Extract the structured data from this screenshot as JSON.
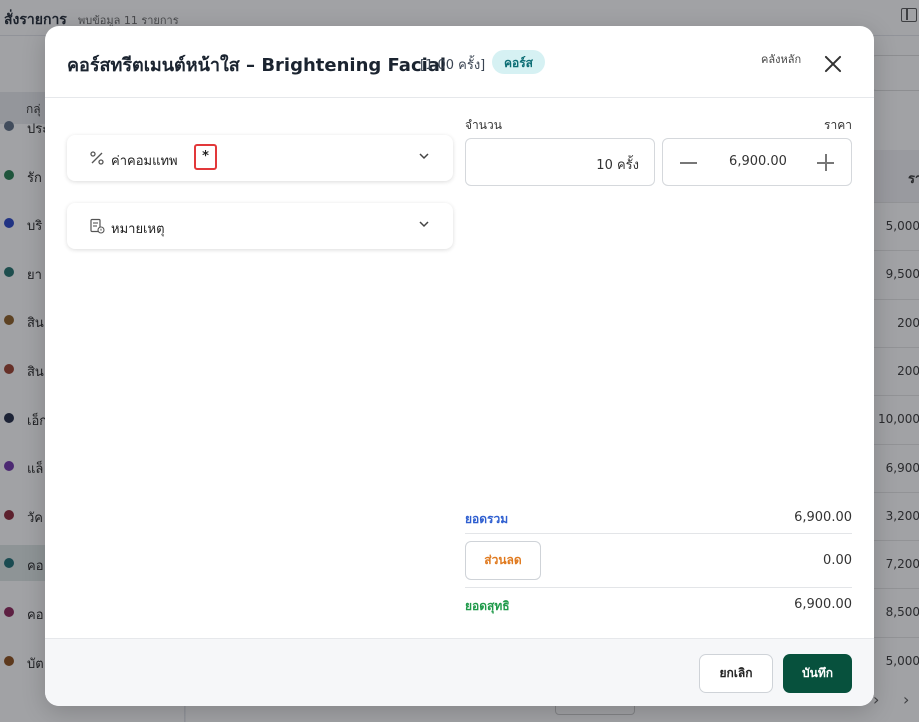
{
  "background": {
    "title": "สั่งรายการ",
    "subtitle": "พบข้อมูล 11 รายการ",
    "group_button": "กลุ่",
    "categories": [
      {
        "label": "ประ",
        "color": "#5b6b82"
      },
      {
        "label": "รัก",
        "color": "#1f7a4a"
      },
      {
        "label": "บริ",
        "color": "#2340c4"
      },
      {
        "label": "ยา",
        "color": "#1e6f6a"
      },
      {
        "label": "สิน",
        "color": "#8a5a1f"
      },
      {
        "label": "สิน",
        "color": "#9a3b28"
      },
      {
        "label": "เอ็ก",
        "color": "#1c2540"
      },
      {
        "label": "แล็",
        "color": "#6d2fa8"
      },
      {
        "label": "วัค",
        "color": "#8a2233"
      },
      {
        "label": "คอ",
        "color": "#17696f"
      },
      {
        "label": "คอ",
        "color": "#8a1f55"
      },
      {
        "label": "บัต",
        "color": "#8a4a15"
      }
    ],
    "table_header": "รา",
    "prices": [
      "5,000",
      "9,500",
      "200",
      "200",
      "10,000",
      "6,900",
      "3,200",
      "7,200",
      "8,500",
      "5,000"
    ]
  },
  "modal": {
    "title": "คอร์สทรีตเมนต์หน้าใส – Brightening Facial",
    "quantity_label": "[1.00 ครั้ง]",
    "badge": "คอร์ส",
    "warehouse": "คลังหลัก",
    "sections": {
      "commission": "ค่าคอมแทพ",
      "required_mark": "*",
      "note": "หมายเหตุ"
    },
    "fields": {
      "quantity_header": "จำนวน",
      "price_header": "ราคา",
      "quantity_value": "10 ครั้ง",
      "price_value": "6,900.00"
    },
    "summary": {
      "total_label": "ยอดรวม",
      "total_value": "6,900.00",
      "discount_label": "ส่วนลด",
      "discount_value": "0.00",
      "net_label": "ยอดสุทธิ",
      "net_value": "6,900.00"
    },
    "buttons": {
      "cancel": "ยกเลิก",
      "save": "บันทึก"
    },
    "colors": {
      "primary": "#07513d",
      "badge_bg": "#d6f1f3",
      "total_label": "#2f5fd0",
      "net_label": "#1f9a4a",
      "discount": "#e07a1f",
      "highlight": "#e2383a"
    }
  }
}
